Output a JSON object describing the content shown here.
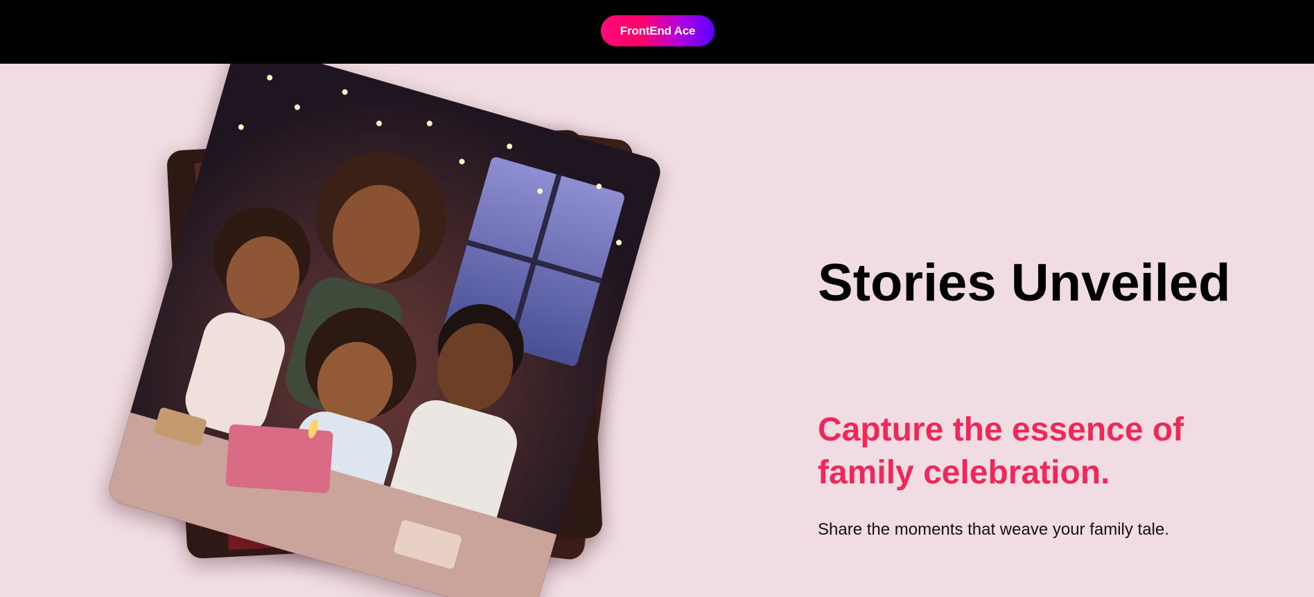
{
  "header": {
    "brand": "FrontEnd Ace",
    "brand_gradient": [
      "#ff0a7a",
      "#b000e0",
      "#5a00ff"
    ]
  },
  "hero": {
    "title": "Stories Unveiled",
    "subtitle": "Capture the essence of family celebration.",
    "description": "Share the moments that weave your family tale."
  },
  "gallery": {
    "slides": [
      {
        "kind": "illustration",
        "subject": "family-celebration"
      },
      {
        "kind": "illustration",
        "subject": "family-celebration"
      },
      {
        "kind": "illustration",
        "subject": "family-celebration"
      }
    ],
    "active_index": 0
  },
  "colors": {
    "accent": "#f0285a",
    "background": "#f0dce2",
    "header_bg": "#000000"
  }
}
